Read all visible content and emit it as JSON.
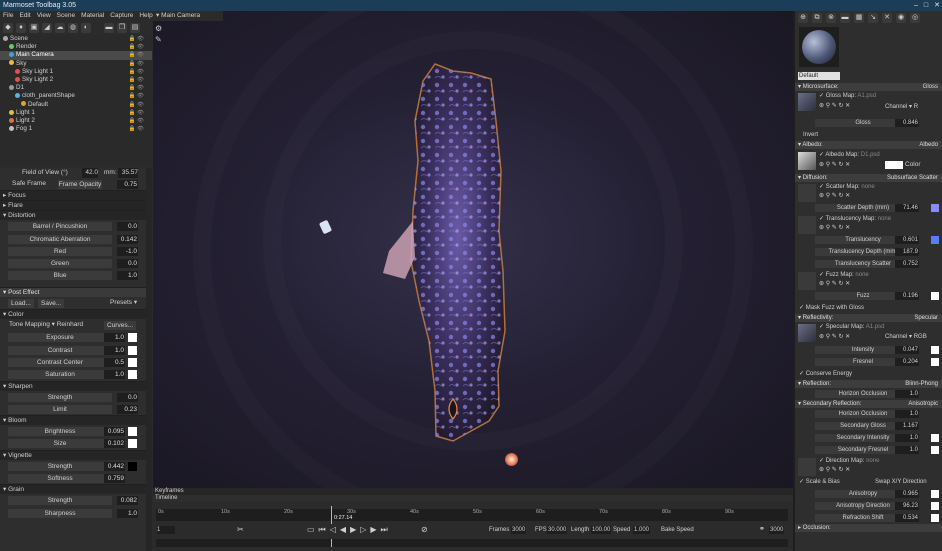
{
  "app": {
    "title": "Marmoset Toolbag 3.05"
  },
  "menu": [
    "File",
    "Edit",
    "View",
    "Scene",
    "Material",
    "Capture",
    "Help"
  ],
  "scene_tree": [
    {
      "label": "Scene",
      "indent": 0,
      "color": "#aaaaaa"
    },
    {
      "label": "Render",
      "indent": 1,
      "color": "#5fd05f"
    },
    {
      "label": "Main Camera",
      "indent": 1,
      "color": "#3fa0e0",
      "selected": true
    },
    {
      "label": "Sky",
      "indent": 1,
      "color": "#e0c040"
    },
    {
      "label": "Sky Light 1",
      "indent": 2,
      "color": "#e05050"
    },
    {
      "label": "Sky Light 2",
      "indent": 2,
      "color": "#e05050"
    },
    {
      "label": "D1",
      "indent": 1,
      "color": "#999999"
    },
    {
      "label": "cloth_parentShape",
      "indent": 2,
      "color": "#60b0e0"
    },
    {
      "label": "Default",
      "indent": 3,
      "color": "#e0a040"
    },
    {
      "label": "Light 1",
      "indent": 1,
      "color": "#e0c040"
    },
    {
      "label": "Light 2",
      "indent": 1,
      "color": "#e07040"
    },
    {
      "label": "Fog 1",
      "indent": 1,
      "color": "#c0c0c0"
    }
  ],
  "camera_props": {
    "fov_label": "Field of View (°)",
    "fov": "42.0",
    "mm_label": "mm:",
    "mm": "35.57",
    "safe_frame": "Safe Frame",
    "frame_opacity_label": "Frame Opacity",
    "frame_opacity": "0.75",
    "focus": "Focus",
    "flare": "Flare",
    "distortion": "Distortion",
    "distortion_rows": [
      {
        "label": "Barrel / Pincushion",
        "value": "0.0"
      },
      {
        "label": "Chromatic Aberration",
        "value": "0.142"
      },
      {
        "label": "Red",
        "value": "-1.0"
      },
      {
        "label": "Green",
        "value": "0.0"
      },
      {
        "label": "Blue",
        "value": "1.0"
      }
    ],
    "post_effect": "Post Effect",
    "load": "Load...",
    "save": "Save...",
    "presets": "Presets",
    "color": "Color",
    "tone_mapping": "Tone Mapping",
    "tone_value": "Reinhard",
    "curves": "Curves...",
    "color_rows": [
      {
        "label": "Exposure",
        "value": "1.0"
      },
      {
        "label": "Contrast",
        "value": "1.0"
      },
      {
        "label": "Contrast Center",
        "value": "0.5"
      },
      {
        "label": "Saturation",
        "value": "1.0"
      }
    ],
    "sharpen": "Sharpen",
    "sharpen_rows": [
      {
        "label": "Strength",
        "value": "0.0"
      },
      {
        "label": "Limit",
        "value": "0.23"
      }
    ],
    "bloom": "Bloom",
    "bloom_rows": [
      {
        "label": "Brightness",
        "value": "0.095"
      },
      {
        "label": "Size",
        "value": "0.102"
      }
    ],
    "vignette": "Vignette",
    "vignette_rows": [
      {
        "label": "Strength",
        "value": "0.442"
      },
      {
        "label": "Softness",
        "value": "0.759"
      }
    ],
    "grain": "Grain",
    "grain_rows": [
      {
        "label": "Strength",
        "value": "0.082"
      },
      {
        "label": "Sharpness",
        "value": "1.0"
      }
    ]
  },
  "viewport": {
    "tab": "Main Camera"
  },
  "timeline": {
    "keyframes": "Keyframes",
    "timeline": "Timeline",
    "ticks": [
      "0s",
      "10s",
      "20s",
      "30s",
      "40s",
      "50s",
      "60s",
      "70s",
      "80s",
      "90s"
    ],
    "playhead": "0:27.14",
    "frame": "1",
    "frames_label": "Frames",
    "frames": "3000",
    "fps_label": "FPS",
    "fps": "30.000",
    "length_label": "Length",
    "length": "100.00",
    "speed_label": "Speed",
    "speed": "1.000",
    "bake": "Bake Speed",
    "end": "3000"
  },
  "material": {
    "name": "Default",
    "microsurface": "Microsurface:",
    "microsurface_val": "Gloss",
    "gloss_map": "Gloss Map:",
    "gloss_map_file": "A1.psd",
    "channel": "Channel",
    "channel_val": "R",
    "gloss_label": "Gloss",
    "gloss": "0.846",
    "invert": "Invert",
    "albedo": "Albedo:",
    "albedo_val": "Albedo",
    "albedo_map": "Albedo Map:",
    "albedo_map_file": "D1.psd",
    "color": "Color",
    "diffusion": "Diffusion:",
    "diffusion_val": "Subsurface Scatter",
    "scatter_map": "Scatter Map:",
    "none": "none",
    "scatter_depth_label": "Scatter Depth (mm)",
    "scatter_depth": "71.46",
    "transl_map": "Translucency Map:",
    "transl_label": "Translucency",
    "transl": "0.601",
    "transl_depth_label": "Translucency Depth (mm)",
    "transl_depth": "187.9",
    "transl_scatter_label": "Translucency Scatter",
    "transl_scatter": "0.752",
    "fuzz_map": "Fuzz Map:",
    "fuzz_label": "Fuzz",
    "fuzz": "0.196",
    "mask_fuzz": "Mask Fuzz with Gloss",
    "reflectivity": "Reflectivity:",
    "reflectivity_val": "Specular",
    "spec_map": "Specular Map:",
    "spec_map_file": "A1.psd",
    "spec_channel": "RGB",
    "intensity_label": "Intensity",
    "intensity": "0.047",
    "fresnel_label": "Fresnel",
    "fresnel": "0.204",
    "conserve": "Conserve Energy",
    "reflection": "Reflection:",
    "reflection_val": "Blinn-Phong",
    "horizon_label": "Horizon Occlusion",
    "horizon": "1.0",
    "sec_reflection": "Secondary Reflection:",
    "sec_reflection_val": "Anisotropic",
    "horizon2": "1.0",
    "sec_gloss_label": "Secondary Gloss",
    "sec_gloss": "1.167",
    "sec_int_label": "Secondary Intensity",
    "sec_int": "1.0",
    "sec_fres_label": "Secondary Fresnel",
    "sec_fres": "1.0",
    "dir_map": "Direction Map:",
    "scale_bias": "Scale & Bias",
    "swap": "Swap X/Y Direction",
    "aniso_label": "Anisotropy",
    "aniso": "0.965",
    "aniso_dir_label": "Anisotropy Direction",
    "aniso_dir": "96.23",
    "refr_shift_label": "Refraction Shift",
    "refr_shift": "0.534",
    "occlusion": "Occlusion:"
  }
}
